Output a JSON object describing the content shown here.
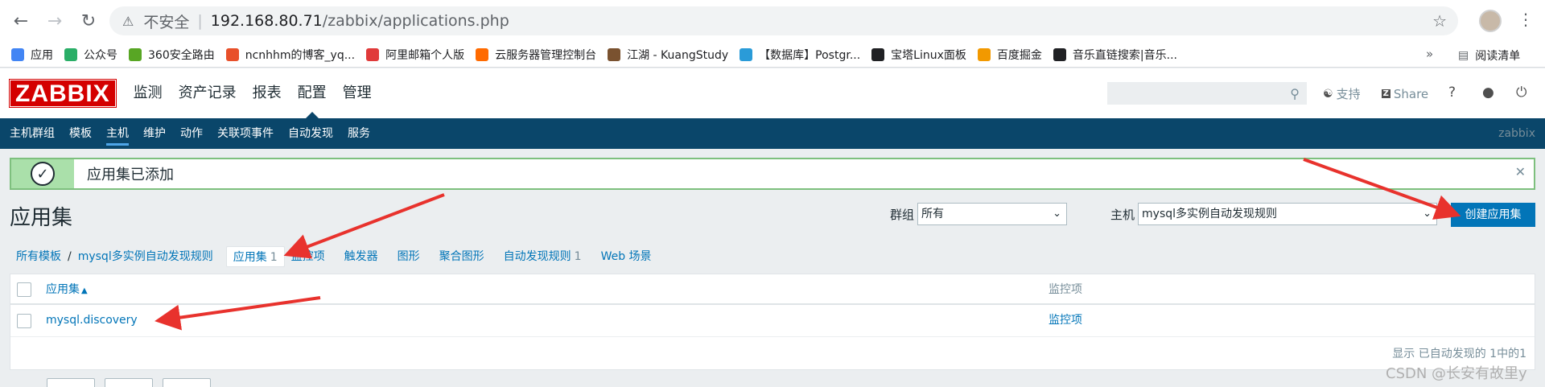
{
  "browser": {
    "insecure_label": "不安全",
    "url_host": "192.168.80.71",
    "url_path": "/zabbix/applications.php",
    "bookmarks": [
      {
        "label": "应用",
        "color": "#4285f4"
      },
      {
        "label": "公众号",
        "color": "#2aae67"
      },
      {
        "label": "360安全路由",
        "color": "#58a624"
      },
      {
        "label": "ncnhhm的博客_yq...",
        "color": "#e8502a"
      },
      {
        "label": "阿里邮箱个人版",
        "color": "#e03a3a"
      },
      {
        "label": "云服务器管理控制台",
        "color": "#ff6a00"
      },
      {
        "label": "江湖 - KuangStudy",
        "color": "#7a5230"
      },
      {
        "label": "【数据库】Postgr...",
        "color": "#2a9bd8"
      },
      {
        "label": "宝塔Linux面板",
        "color": "#202124"
      },
      {
        "label": "百度掘金",
        "color": "#f29900"
      },
      {
        "label": "音乐直链搜索|音乐...",
        "color": "#202124"
      }
    ],
    "more": "»",
    "reading_list": "阅读清单"
  },
  "zabbix": {
    "logo": "ZABBIX",
    "top_menu": [
      "监测",
      "资产记录",
      "报表",
      "配置",
      "管理"
    ],
    "header_links": {
      "support": "支持",
      "share": "Share"
    },
    "sub_menu": [
      "主机群组",
      "模板",
      "主机",
      "维护",
      "动作",
      "关联项事件",
      "自动发现",
      "服务"
    ],
    "server_name": "zabbix",
    "message": "应用集已添加",
    "page_title": "应用集",
    "filter_group_label": "群组",
    "filter_group_value": "所有",
    "filter_host_label": "主机",
    "filter_host_value": "mysql多实例自动发现规则",
    "create_button": "创建应用集",
    "breadcrumbs": {
      "all_templates": "所有模板",
      "slash": "/",
      "template": "mysql多实例自动发现规则",
      "applications": "应用集",
      "applications_count": "1",
      "items": "监控项",
      "triggers": "触发器",
      "graphs": "图形",
      "screens": "聚合图形",
      "discovery": "自动发现规则",
      "discovery_count": "1",
      "web": "Web 场景"
    },
    "table": {
      "col_application": "应用集",
      "col_items": "监控项",
      "rows": [
        {
          "application": "mysql.discovery",
          "items": "监控项"
        }
      ],
      "footer": "显示 已自动发现的 1中的1"
    }
  },
  "watermark": "CSDN @长安有故里y"
}
